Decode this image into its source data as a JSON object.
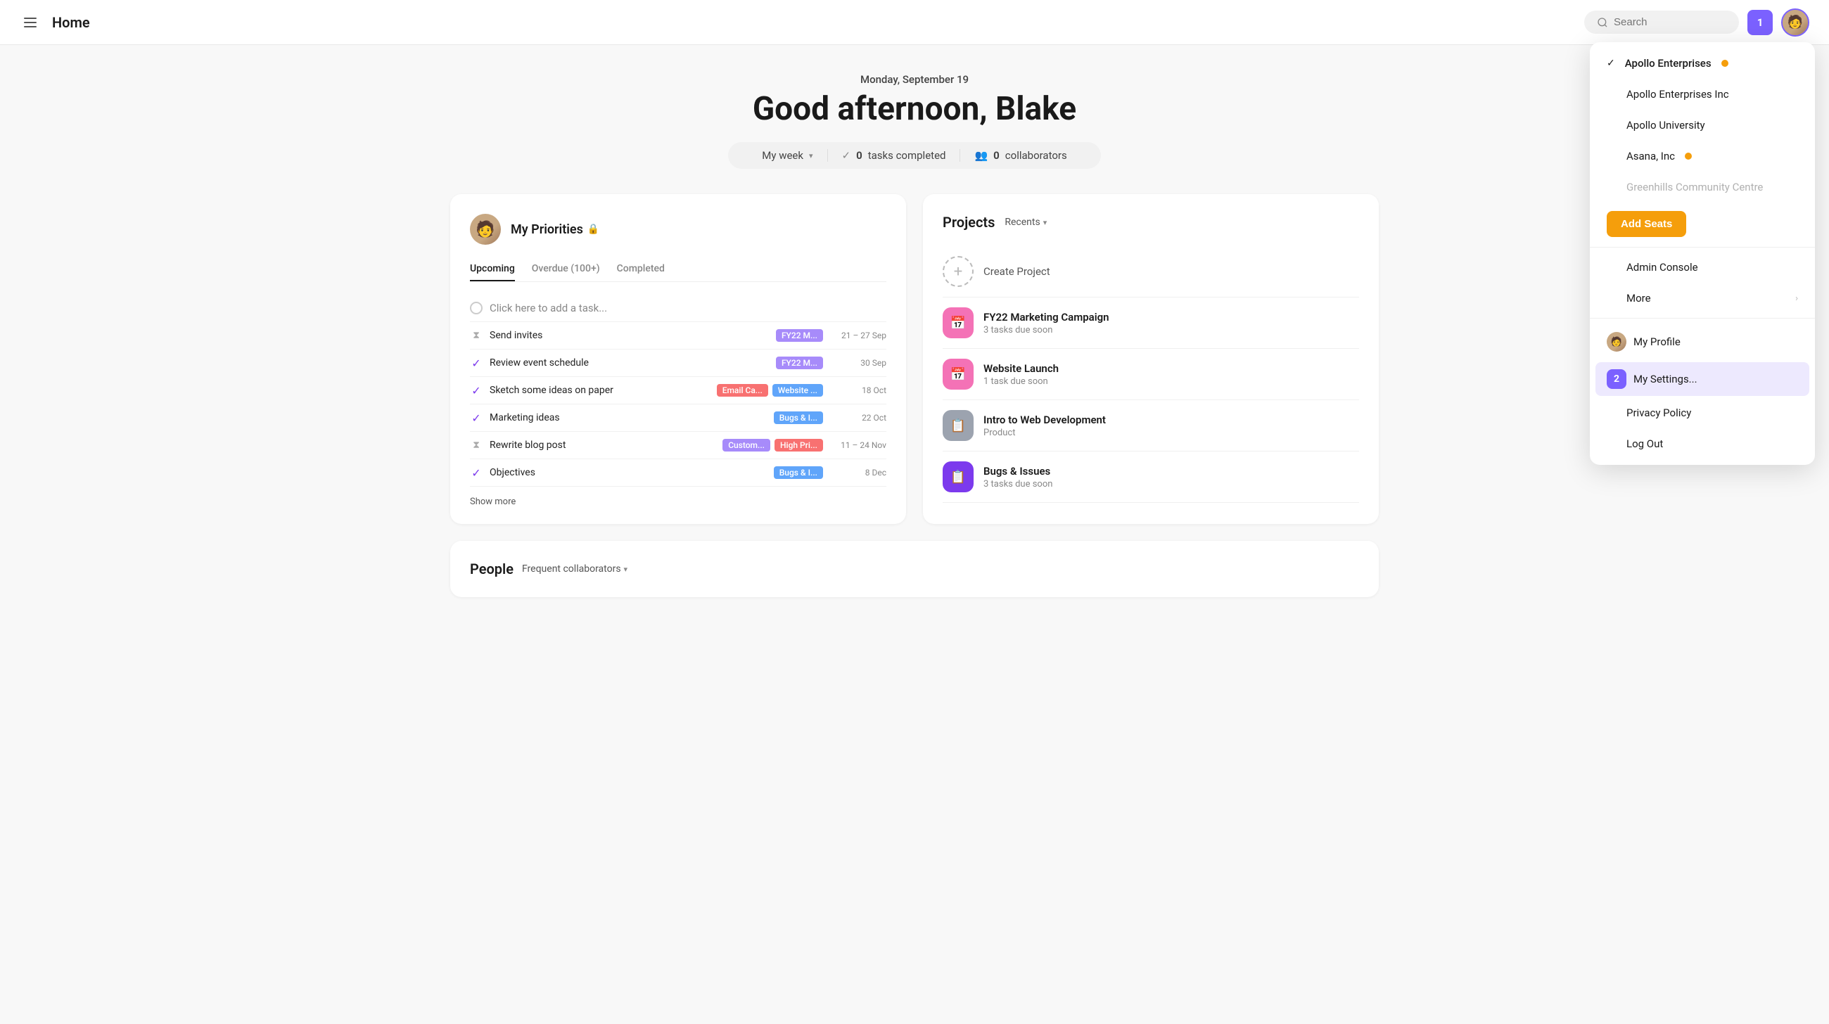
{
  "topbar": {
    "title": "Home",
    "search_placeholder": "Search",
    "notif_count": "1",
    "avatar_emoji": "🧑"
  },
  "greeting": {
    "date": "Monday, September 19",
    "message": "Good afternoon, Blake",
    "stats": {
      "week_label": "My week",
      "tasks_count": "0",
      "tasks_label": "tasks completed",
      "collab_count": "0",
      "collab_label": "collaborators"
    }
  },
  "priorities": {
    "title": "My Priorities",
    "lock": "🔒",
    "tabs": [
      "Upcoming",
      "Overdue (100+)",
      "Completed"
    ],
    "active_tab": "Upcoming",
    "add_placeholder": "Click here to add a task...",
    "tasks": [
      {
        "name": "Send invites",
        "tag1": "FY22 M...",
        "tag1_color": "purple",
        "date": "21 – 27 Sep",
        "icon": "hourglass"
      },
      {
        "name": "Review event schedule",
        "tag1": "FY22 M...",
        "tag1_color": "purple",
        "date": "30 Sep",
        "icon": "check"
      },
      {
        "name": "Sketch some ideas on paper",
        "tag1": "Email Ca...",
        "tag1_color": "red",
        "tag2": "Website ...",
        "tag2_color": "blue",
        "date": "18 Oct",
        "icon": "check"
      },
      {
        "name": "Marketing ideas",
        "tag1": "Bugs & I...",
        "tag1_color": "blue",
        "date": "22 Oct",
        "icon": "check"
      },
      {
        "name": "Rewrite blog post",
        "tag1": "Custom...",
        "tag1_color": "purple",
        "tag2": "High Pri...",
        "tag2_color": "red",
        "date": "11 – 24 Nov",
        "icon": "hourglass"
      },
      {
        "name": "Objectives",
        "tag1": "Bugs & I...",
        "tag1_color": "blue",
        "date": "8 Dec",
        "icon": "check"
      }
    ],
    "show_more": "Show more"
  },
  "projects": {
    "title": "Projects",
    "recents_label": "Recents",
    "create_label": "Create Project",
    "items": [
      {
        "name": "FY22 Marketing Campaign",
        "sub": "3 tasks due soon",
        "color": "pink",
        "icon": "📅"
      },
      {
        "name": "Website Launch",
        "sub": "1 task due soon",
        "color": "pink",
        "icon": "📅"
      },
      {
        "name": "Intro to Web Development",
        "sub": "Product",
        "color": "gray",
        "icon": "📋"
      },
      {
        "name": "Bugs & Issues",
        "sub": "3 tasks due soon",
        "color": "purple",
        "icon": "📋"
      }
    ]
  },
  "people": {
    "title": "People",
    "collab_label": "Frequent collaborators"
  },
  "dropdown": {
    "items": [
      {
        "id": "apollo-enterprises",
        "label": "Apollo Enterprises",
        "dot": true,
        "check": true
      },
      {
        "id": "apollo-enterprises-inc",
        "label": "Apollo Enterprises Inc",
        "dot": false,
        "check": false
      },
      {
        "id": "apollo-university",
        "label": "Apollo University",
        "dot": false,
        "check": false
      },
      {
        "id": "asana-inc",
        "label": "Asana, Inc",
        "dot": true,
        "check": false
      },
      {
        "id": "greenhills",
        "label": "Greenhills Community Centre",
        "dot": false,
        "check": false,
        "greyed": true
      }
    ],
    "add_seats_label": "Add Seats",
    "admin_console_label": "Admin Console",
    "more_label": "More",
    "my_profile_label": "My Profile",
    "my_settings_label": "My Settings...",
    "privacy_policy_label": "Privacy Policy",
    "log_out_label": "Log Out"
  }
}
